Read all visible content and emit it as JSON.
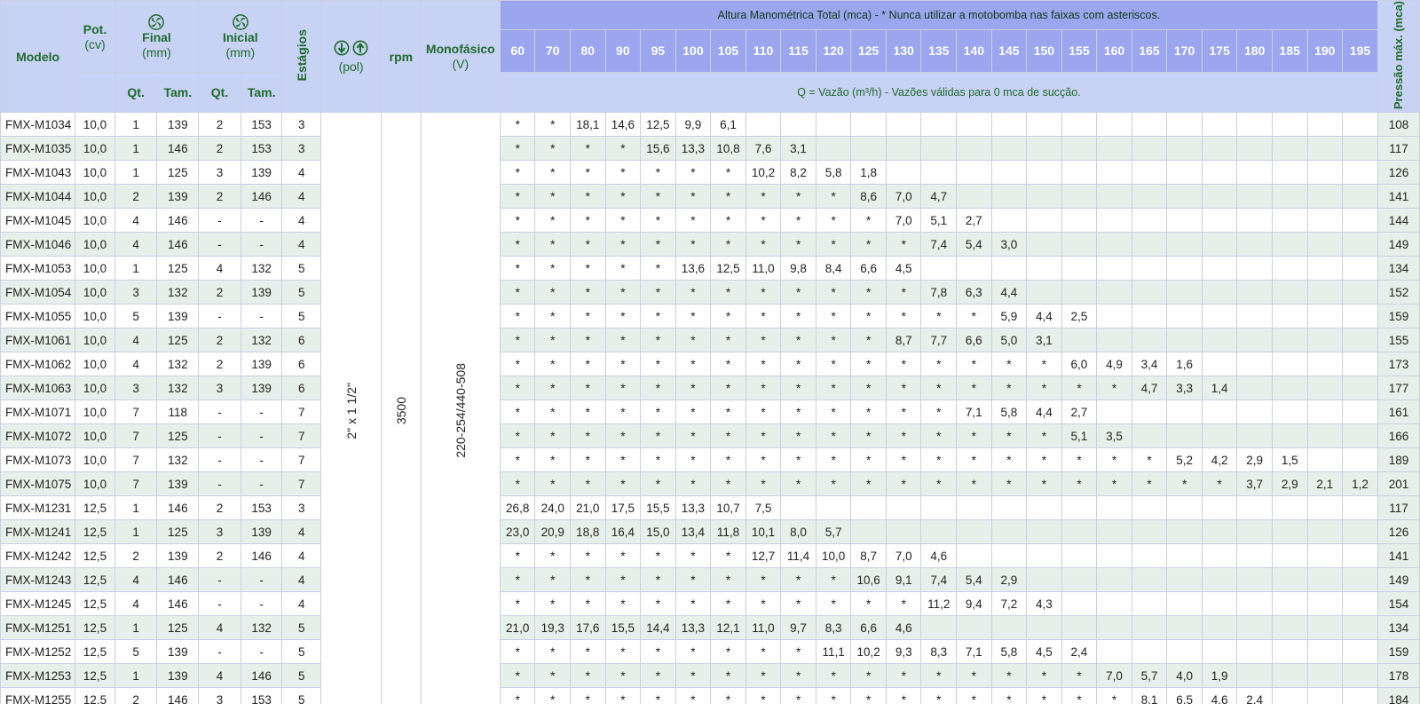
{
  "header": {
    "modelo": "Modelo",
    "pot": "Pot.",
    "pot_unit": "(cv)",
    "final": "Final",
    "final_unit": "(mm)",
    "inicial": "Inicial",
    "inicial_unit": "(mm)",
    "qt": "Qt.",
    "tam": "Tam.",
    "estagios": "Estágios",
    "pol_unit": "(pol)",
    "rpm": "rpm",
    "monofasico": "Monofásico",
    "monofasico_unit": "(V)",
    "altura_note": "Altura Manométrica Total (mca) - * Nunca utilizar a motobomba nas faixas com asteriscos.",
    "vazao_note": "Q = Vazão (m³/h) - Vazões válidas para 0 mca de sucção.",
    "pressao": "Pressão máx. (mca)",
    "heights": [
      "60",
      "70",
      "80",
      "90",
      "95",
      "100",
      "105",
      "110",
      "115",
      "120",
      "125",
      "130",
      "135",
      "140",
      "145",
      "150",
      "155",
      "160",
      "165",
      "170",
      "175",
      "180",
      "185",
      "190",
      "195"
    ]
  },
  "merged": {
    "pol": "2\" x 1 1/2\"",
    "rpm": "3500",
    "voltage": "220-254/440-508"
  },
  "rows": [
    {
      "model": "FMX-M1034",
      "pot": "10,0",
      "fq": "1",
      "ft": "139",
      "iq": "2",
      "it": "153",
      "est": "3",
      "v": [
        "*",
        "*",
        "18,1",
        "14,6",
        "12,5",
        "9,9",
        "6,1",
        "",
        "",
        "",
        "",
        "",
        "",
        "",
        "",
        "",
        "",
        "",
        "",
        "",
        "",
        "",
        "",
        "",
        ""
      ],
      "p": "108"
    },
    {
      "model": "FMX-M1035",
      "pot": "10,0",
      "fq": "1",
      "ft": "146",
      "iq": "2",
      "it": "153",
      "est": "3",
      "v": [
        "*",
        "*",
        "*",
        "*",
        "15,6",
        "13,3",
        "10,8",
        "7,6",
        "3,1",
        "",
        "",
        "",
        "",
        "",
        "",
        "",
        "",
        "",
        "",
        "",
        "",
        "",
        "",
        "",
        ""
      ],
      "p": "117"
    },
    {
      "model": "FMX-M1043",
      "pot": "10,0",
      "fq": "1",
      "ft": "125",
      "iq": "3",
      "it": "139",
      "est": "4",
      "v": [
        "*",
        "*",
        "*",
        "*",
        "*",
        "*",
        "*",
        "10,2",
        "8,2",
        "5,8",
        "1,8",
        "",
        "",
        "",
        "",
        "",
        "",
        "",
        "",
        "",
        "",
        "",
        "",
        "",
        ""
      ],
      "p": "126"
    },
    {
      "model": "FMX-M1044",
      "pot": "10,0",
      "fq": "2",
      "ft": "139",
      "iq": "2",
      "it": "146",
      "est": "4",
      "v": [
        "*",
        "*",
        "*",
        "*",
        "*",
        "*",
        "*",
        "*",
        "*",
        "*",
        "8,6",
        "7,0",
        "4,7",
        "",
        "",
        "",
        "",
        "",
        "",
        "",
        "",
        "",
        "",
        "",
        ""
      ],
      "p": "141"
    },
    {
      "model": "FMX-M1045",
      "pot": "10,0",
      "fq": "4",
      "ft": "146",
      "iq": "-",
      "it": "-",
      "est": "4",
      "v": [
        "*",
        "*",
        "*",
        "*",
        "*",
        "*",
        "*",
        "*",
        "*",
        "*",
        "*",
        "7,0",
        "5,1",
        "2,7",
        "",
        "",
        "",
        "",
        "",
        "",
        "",
        "",
        "",
        "",
        ""
      ],
      "p": "144"
    },
    {
      "model": "FMX-M1046",
      "pot": "10,0",
      "fq": "4",
      "ft": "146",
      "iq": "-",
      "it": "-",
      "est": "4",
      "v": [
        "*",
        "*",
        "*",
        "*",
        "*",
        "*",
        "*",
        "*",
        "*",
        "*",
        "*",
        "*",
        "7,4",
        "5,4",
        "3,0",
        "",
        "",
        "",
        "",
        "",
        "",
        "",
        "",
        "",
        ""
      ],
      "p": "149"
    },
    {
      "model": "FMX-M1053",
      "pot": "10,0",
      "fq": "1",
      "ft": "125",
      "iq": "4",
      "it": "132",
      "est": "5",
      "v": [
        "*",
        "*",
        "*",
        "*",
        "*",
        "13,6",
        "12,5",
        "11,0",
        "9,8",
        "8,4",
        "6,6",
        "4,5",
        "",
        "",
        "",
        "",
        "",
        "",
        "",
        "",
        "",
        "",
        "",
        "",
        ""
      ],
      "p": "134"
    },
    {
      "model": "FMX-M1054",
      "pot": "10,0",
      "fq": "3",
      "ft": "132",
      "iq": "2",
      "it": "139",
      "est": "5",
      "v": [
        "*",
        "*",
        "*",
        "*",
        "*",
        "*",
        "*",
        "*",
        "*",
        "*",
        "*",
        "*",
        "7,8",
        "6,3",
        "4,4",
        "",
        "",
        "",
        "",
        "",
        "",
        "",
        "",
        "",
        ""
      ],
      "p": "152"
    },
    {
      "model": "FMX-M1055",
      "pot": "10,0",
      "fq": "5",
      "ft": "139",
      "iq": "-",
      "it": "-",
      "est": "5",
      "v": [
        "*",
        "*",
        "*",
        "*",
        "*",
        "*",
        "*",
        "*",
        "*",
        "*",
        "*",
        "*",
        "*",
        "*",
        "5,9",
        "4,4",
        "2,5",
        "",
        "",
        "",
        "",
        "",
        "",
        "",
        ""
      ],
      "p": "159"
    },
    {
      "model": "FMX-M1061",
      "pot": "10,0",
      "fq": "4",
      "ft": "125",
      "iq": "2",
      "it": "132",
      "est": "6",
      "v": [
        "*",
        "*",
        "*",
        "*",
        "*",
        "*",
        "*",
        "*",
        "*",
        "*",
        "*",
        "8,7",
        "7,7",
        "6,6",
        "5,0",
        "3,1",
        "",
        "",
        "",
        "",
        "",
        "",
        "",
        "",
        ""
      ],
      "p": "155"
    },
    {
      "model": "FMX-M1062",
      "pot": "10,0",
      "fq": "4",
      "ft": "132",
      "iq": "2",
      "it": "139",
      "est": "6",
      "v": [
        "*",
        "*",
        "*",
        "*",
        "*",
        "*",
        "*",
        "*",
        "*",
        "*",
        "*",
        "*",
        "*",
        "*",
        "*",
        "*",
        "6,0",
        "4,9",
        "3,4",
        "1,6",
        "",
        "",
        "",
        "",
        ""
      ],
      "p": "173"
    },
    {
      "model": "FMX-M1063",
      "pot": "10,0",
      "fq": "3",
      "ft": "132",
      "iq": "3",
      "it": "139",
      "est": "6",
      "v": [
        "*",
        "*",
        "*",
        "*",
        "*",
        "*",
        "*",
        "*",
        "*",
        "*",
        "*",
        "*",
        "*",
        "*",
        "*",
        "*",
        "*",
        "*",
        "4,7",
        "3,3",
        "1,4",
        "",
        "",
        "",
        ""
      ],
      "p": "177"
    },
    {
      "model": "FMX-M1071",
      "pot": "10,0",
      "fq": "7",
      "ft": "118",
      "iq": "-",
      "it": "-",
      "est": "7",
      "v": [
        "*",
        "*",
        "*",
        "*",
        "*",
        "*",
        "*",
        "*",
        "*",
        "*",
        "*",
        "*",
        "*",
        "7,1",
        "5,8",
        "4,4",
        "2,7",
        "",
        "",
        "",
        "",
        "",
        "",
        "",
        ""
      ],
      "p": "161"
    },
    {
      "model": "FMX-M1072",
      "pot": "10,0",
      "fq": "7",
      "ft": "125",
      "iq": "-",
      "it": "-",
      "est": "7",
      "v": [
        "*",
        "*",
        "*",
        "*",
        "*",
        "*",
        "*",
        "*",
        "*",
        "*",
        "*",
        "*",
        "*",
        "*",
        "*",
        "*",
        "5,1",
        "3,5",
        "",
        "",
        "",
        "",
        "",
        "",
        ""
      ],
      "p": "166"
    },
    {
      "model": "FMX-M1073",
      "pot": "10,0",
      "fq": "7",
      "ft": "132",
      "iq": "-",
      "it": "-",
      "est": "7",
      "v": [
        "*",
        "*",
        "*",
        "*",
        "*",
        "*",
        "*",
        "*",
        "*",
        "*",
        "*",
        "*",
        "*",
        "*",
        "*",
        "*",
        "*",
        "*",
        "*",
        "5,2",
        "4,2",
        "2,9",
        "1,5",
        "",
        ""
      ],
      "p": "189"
    },
    {
      "model": "FMX-M1075",
      "pot": "10,0",
      "fq": "7",
      "ft": "139",
      "iq": "-",
      "it": "-",
      "est": "7",
      "v": [
        "*",
        "*",
        "*",
        "*",
        "*",
        "*",
        "*",
        "*",
        "*",
        "*",
        "*",
        "*",
        "*",
        "*",
        "*",
        "*",
        "*",
        "*",
        "*",
        "*",
        "*",
        "3,7",
        "2,9",
        "2,1",
        "1,2"
      ],
      "p": "201"
    },
    {
      "model": "FMX-M1231",
      "pot": "12,5",
      "fq": "1",
      "ft": "146",
      "iq": "2",
      "it": "153",
      "est": "3",
      "v": [
        "26,8",
        "24,0",
        "21,0",
        "17,5",
        "15,5",
        "13,3",
        "10,7",
        "7,5",
        "",
        "",
        "",
        "",
        "",
        "",
        "",
        "",
        "",
        "",
        "",
        "",
        "",
        "",
        "",
        "",
        ""
      ],
      "p": "117"
    },
    {
      "model": "FMX-M1241",
      "pot": "12,5",
      "fq": "1",
      "ft": "125",
      "iq": "3",
      "it": "139",
      "est": "4",
      "v": [
        "23,0",
        "20,9",
        "18,8",
        "16,4",
        "15,0",
        "13,4",
        "11,8",
        "10,1",
        "8,0",
        "5,7",
        "",
        "",
        "",
        "",
        "",
        "",
        "",
        "",
        "",
        "",
        "",
        "",
        "",
        "",
        ""
      ],
      "p": "126"
    },
    {
      "model": "FMX-M1242",
      "pot": "12,5",
      "fq": "2",
      "ft": "139",
      "iq": "2",
      "it": "146",
      "est": "4",
      "v": [
        "*",
        "*",
        "*",
        "*",
        "*",
        "*",
        "*",
        "12,7",
        "11,4",
        "10,0",
        "8,7",
        "7,0",
        "4,6",
        "",
        "",
        "",
        "",
        "",
        "",
        "",
        "",
        "",
        "",
        "",
        ""
      ],
      "p": "141"
    },
    {
      "model": "FMX-M1243",
      "pot": "12,5",
      "fq": "4",
      "ft": "146",
      "iq": "-",
      "it": "-",
      "est": "4",
      "v": [
        "*",
        "*",
        "*",
        "*",
        "*",
        "*",
        "*",
        "*",
        "*",
        "*",
        "10,6",
        "9,1",
        "7,4",
        "5,4",
        "2,9",
        "",
        "",
        "",
        "",
        "",
        "",
        "",
        "",
        "",
        ""
      ],
      "p": "149"
    },
    {
      "model": "FMX-M1245",
      "pot": "12,5",
      "fq": "4",
      "ft": "146",
      "iq": "-",
      "it": "-",
      "est": "4",
      "v": [
        "*",
        "*",
        "*",
        "*",
        "*",
        "*",
        "*",
        "*",
        "*",
        "*",
        "*",
        "*",
        "11,2",
        "9,4",
        "7,2",
        "4,3",
        "",
        "",
        "",
        "",
        "",
        "",
        "",
        "",
        ""
      ],
      "p": "154"
    },
    {
      "model": "FMX-M1251",
      "pot": "12,5",
      "fq": "1",
      "ft": "125",
      "iq": "4",
      "it": "132",
      "est": "5",
      "v": [
        "21,0",
        "19,3",
        "17,6",
        "15,5",
        "14,4",
        "13,3",
        "12,1",
        "11,0",
        "9,7",
        "8,3",
        "6,6",
        "4,6",
        "",
        "",
        "",
        "",
        "",
        "",
        "",
        "",
        "",
        "",
        "",
        "",
        ""
      ],
      "p": "134"
    },
    {
      "model": "FMX-M1252",
      "pot": "12,5",
      "fq": "5",
      "ft": "139",
      "iq": "-",
      "it": "-",
      "est": "5",
      "v": [
        "*",
        "*",
        "*",
        "*",
        "*",
        "*",
        "*",
        "*",
        "*",
        "11,1",
        "10,2",
        "9,3",
        "8,3",
        "7,1",
        "5,8",
        "4,5",
        "2,4",
        "",
        "",
        "",
        "",
        "",
        "",
        "",
        ""
      ],
      "p": "159"
    },
    {
      "model": "FMX-M1253",
      "pot": "12,5",
      "fq": "1",
      "ft": "139",
      "iq": "4",
      "it": "146",
      "est": "5",
      "v": [
        "*",
        "*",
        "*",
        "*",
        "*",
        "*",
        "*",
        "*",
        "*",
        "*",
        "*",
        "*",
        "*",
        "*",
        "*",
        "*",
        "*",
        "7,0",
        "5,7",
        "4,0",
        "1,9",
        "",
        "",
        "",
        ""
      ],
      "p": "178"
    },
    {
      "model": "FMX-M1255",
      "pot": "12,5",
      "fq": "2",
      "ft": "146",
      "iq": "3",
      "it": "153",
      "est": "5",
      "v": [
        "*",
        "*",
        "*",
        "*",
        "*",
        "*",
        "*",
        "*",
        "*",
        "*",
        "*",
        "*",
        "*",
        "*",
        "*",
        "*",
        "*",
        "*",
        "8,1",
        "6,5",
        "4,6",
        "2,4",
        "",
        "",
        ""
      ],
      "p": "184"
    }
  ]
}
